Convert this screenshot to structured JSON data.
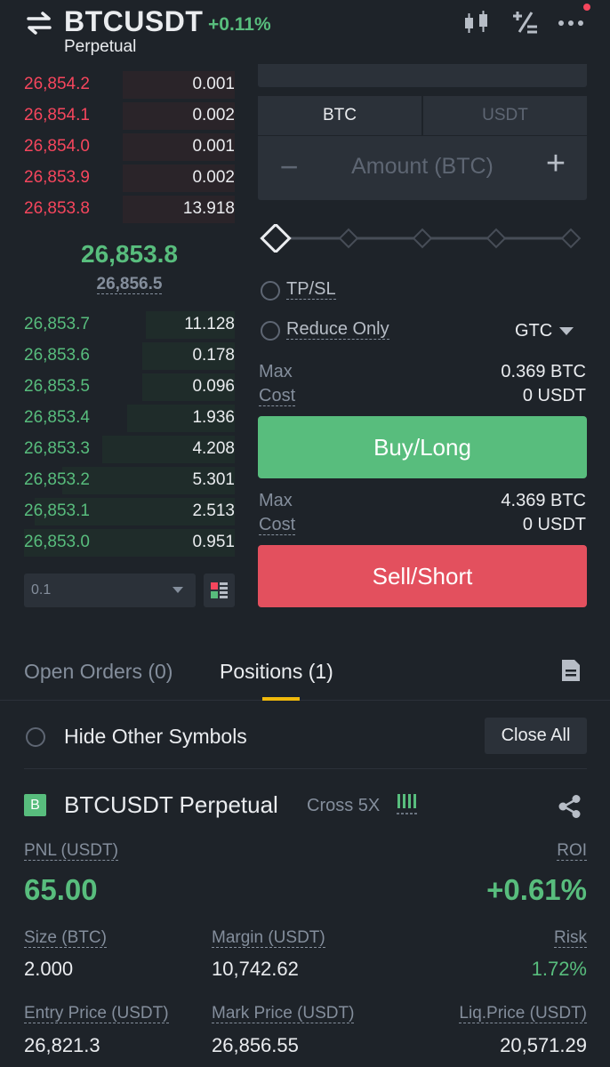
{
  "header": {
    "symbol": "BTCUSDT",
    "change": "+0.11%",
    "contract_type": "Perpetual",
    "icons": [
      "swap-icon",
      "candlestick-icon",
      "calculator-icon",
      "more-icon"
    ]
  },
  "order_book": {
    "asks": [
      {
        "price": "26,854.2",
        "qty": "0.001",
        "depth": 0.53
      },
      {
        "price": "26,854.1",
        "qty": "0.002",
        "depth": 0.53
      },
      {
        "price": "26,854.0",
        "qty": "0.001",
        "depth": 0.53
      },
      {
        "price": "26,853.9",
        "qty": "0.002",
        "depth": 0.53
      },
      {
        "price": "26,853.8",
        "qty": "13.918",
        "depth": 0.53
      }
    ],
    "last_price": "26,853.8",
    "mark_price": "26,856.5",
    "bids": [
      {
        "price": "26,853.7",
        "qty": "11.128",
        "depth": 0.42
      },
      {
        "price": "26,853.6",
        "qty": "0.178",
        "depth": 0.44
      },
      {
        "price": "26,853.5",
        "qty": "0.096",
        "depth": 0.44
      },
      {
        "price": "26,853.4",
        "qty": "1.936",
        "depth": 0.51
      },
      {
        "price": "26,853.3",
        "qty": "4.208",
        "depth": 0.63
      },
      {
        "price": "26,853.2",
        "qty": "5.301",
        "depth": 0.82
      },
      {
        "price": "26,853.1",
        "qty": "2.513",
        "depth": 0.95
      },
      {
        "price": "26,853.0",
        "qty": "0.951",
        "depth": 1.0
      }
    ],
    "depth_select": "0.1"
  },
  "order_form": {
    "unit_tabs": [
      "BTC",
      "USDT"
    ],
    "amount_placeholder": "Amount (BTC)",
    "minus": "−",
    "plus": "+",
    "tpsl_label": "TP/SL",
    "reduce_only_label": "Reduce Only",
    "time_in_force": "GTC",
    "buy": {
      "max_label": "Max",
      "max_value": "0.369 BTC",
      "cost_label": "Cost",
      "cost_value": "0 USDT",
      "button": "Buy/Long"
    },
    "sell": {
      "max_label": "Max",
      "max_value": "4.369 BTC",
      "cost_label": "Cost",
      "cost_value": "0 USDT",
      "button": "Sell/Short"
    }
  },
  "tabs": {
    "open_orders": "Open Orders (0)",
    "positions": "Positions (1)"
  },
  "positions": {
    "hide_other_label": "Hide Other Symbols",
    "close_all": "Close All",
    "card": {
      "side_badge": "B",
      "symbol": "BTCUSDT Perpetual",
      "margin_mode": "Cross 5X",
      "pnl_label": "PNL (USDT)",
      "pnl_value": "65.00",
      "roi_label": "ROI",
      "roi_value": "+0.61%",
      "size_label": "Size (BTC)",
      "size_value": "2.000",
      "margin_label": "Margin (USDT)",
      "margin_value": "10,742.62",
      "risk_label": "Risk",
      "risk_value": "1.72%",
      "entry_label": "Entry Price (USDT)",
      "entry_value": "26,821.3",
      "mark_label": "Mark Price (USDT)",
      "mark_value": "26,856.55",
      "liq_label": "Liq.Price (USDT)",
      "liq_value": "20,571.29"
    }
  },
  "colors": {
    "background": "#1e2329",
    "panel": "#2b3139",
    "buy": "#58bd7d",
    "sell": "#f6465d",
    "accent": "#f0b90b",
    "muted": "#848e9c"
  }
}
